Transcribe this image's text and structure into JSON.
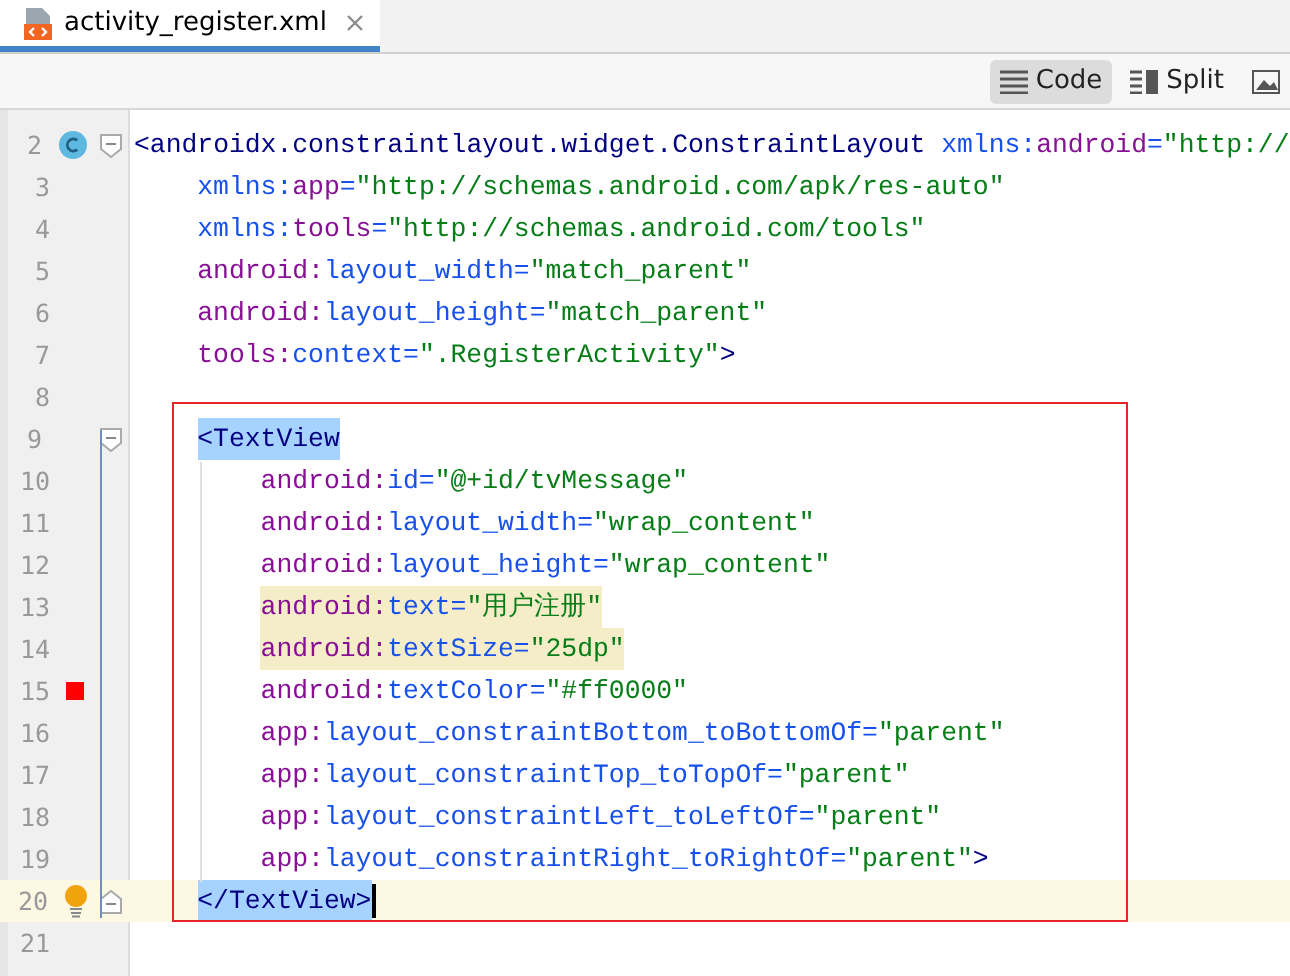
{
  "tabs": [
    {
      "label": "activity_register.xml",
      "selected": true
    }
  ],
  "view_modes": [
    {
      "label": "Code",
      "selected": true
    },
    {
      "label": "Split",
      "selected": false
    },
    {
      "selected": false
    }
  ],
  "lines": [
    {
      "number": "2",
      "gutter": [
        {
          "kind": "class"
        },
        {
          "kind": "fold-start"
        }
      ],
      "segments": [
        {
          "kind": "tag",
          "text": "<androidx.constraintlayout.widget.ConstraintLayout"
        },
        {
          "kind": "attr",
          "text": "xmlns:"
        },
        {
          "kind": "prefix",
          "text": "android"
        },
        {
          "kind": "attr",
          "text": "="
        },
        {
          "kind": "value",
          "text": "\"http://"
        }
      ],
      "children": [
        {
          "number": "3",
          "segments": [
            {
              "kind": "attr",
              "text": "xmlns:"
            },
            {
              "kind": "prefix",
              "text": "app"
            },
            {
              "kind": "attr",
              "text": "="
            },
            {
              "kind": "value",
              "text": "\"http://schemas.android.com/apk/res-auto\""
            }
          ]
        },
        {
          "number": "4",
          "segments": [
            {
              "kind": "attr",
              "text": "xmlns:"
            },
            {
              "kind": "prefix",
              "text": "tools"
            },
            {
              "kind": "attr",
              "text": "="
            },
            {
              "kind": "value",
              "text": "\"http://schemas.android.com/tools\""
            }
          ]
        },
        {
          "number": "5",
          "segments": [
            {
              "kind": "prefix",
              "text": "android:"
            },
            {
              "kind": "attr",
              "text": "layout_width="
            },
            {
              "kind": "value",
              "text": "\"match_parent\""
            }
          ]
        },
        {
          "number": "6",
          "segments": [
            {
              "kind": "prefix",
              "text": "android:"
            },
            {
              "kind": "attr",
              "text": "layout_height="
            },
            {
              "kind": "value",
              "text": "\"match_parent\""
            }
          ]
        },
        {
          "number": "7",
          "segments": [
            {
              "kind": "prefix",
              "text": "tools:"
            },
            {
              "kind": "attr",
              "text": "context="
            },
            {
              "kind": "value",
              "text": "\".RegisterActivity\""
            },
            {
              "kind": "tag",
              "text": ">"
            }
          ]
        },
        {
          "number": "8"
        },
        {
          "number": "9",
          "gutter": [
            {
              "kind": "fold-start"
            }
          ],
          "segments": [
            {
              "kind": "tag",
              "text": "<TextView",
              "selected": true
            }
          ],
          "children": [
            {
              "number": "10",
              "segments": [
                {
                  "kind": "prefix",
                  "text": "android:"
                },
                {
                  "kind": "attr",
                  "text": "id="
                },
                {
                  "kind": "value",
                  "text": "\"@+id/tvMessage\""
                }
              ]
            },
            {
              "number": "11",
              "segments": [
                {
                  "kind": "prefix",
                  "text": "android:"
                },
                {
                  "kind": "attr",
                  "text": "layout_width="
                },
                {
                  "kind": "value",
                  "text": "\"wrap_content\""
                }
              ]
            },
            {
              "number": "12",
              "segments": [
                {
                  "kind": "prefix",
                  "text": "android:"
                },
                {
                  "kind": "attr",
                  "text": "layout_height="
                },
                {
                  "kind": "value",
                  "text": "\"wrap_content\""
                }
              ]
            },
            {
              "number": "13",
              "highlighted": true,
              "segments": [
                {
                  "kind": "prefix",
                  "text": "android:"
                },
                {
                  "kind": "attr",
                  "text": "text="
                },
                {
                  "kind": "value",
                  "text": "\"用户注册\""
                }
              ]
            },
            {
              "number": "14",
              "highlighted": true,
              "segments": [
                {
                  "kind": "prefix",
                  "text": "android:"
                },
                {
                  "kind": "attr",
                  "text": "textSize="
                },
                {
                  "kind": "value",
                  "text": "\"25dp\""
                }
              ]
            },
            {
              "number": "15",
              "gutter": [
                {
                  "kind": "color",
                  "color": "#ff0000"
                }
              ],
              "segments": [
                {
                  "kind": "prefix",
                  "text": "android:"
                },
                {
                  "kind": "attr",
                  "text": "textColor="
                },
                {
                  "kind": "value",
                  "text": "\"#ff0000\""
                }
              ]
            },
            {
              "number": "16",
              "segments": [
                {
                  "kind": "prefix",
                  "text": "app:"
                },
                {
                  "kind": "attr",
                  "text": "layout_constraintBottom_toBottomOf="
                },
                {
                  "kind": "value",
                  "text": "\"parent\""
                }
              ]
            },
            {
              "number": "17",
              "segments": [
                {
                  "kind": "prefix",
                  "text": "app:"
                },
                {
                  "kind": "attr",
                  "text": "layout_constraintTop_toTopOf="
                },
                {
                  "kind": "value",
                  "text": "\"parent\""
                }
              ]
            },
            {
              "number": "18",
              "segments": [
                {
                  "kind": "prefix",
                  "text": "app:"
                },
                {
                  "kind": "attr",
                  "text": "layout_constraintLeft_toLeftOf="
                },
                {
                  "kind": "value",
                  "text": "\"parent\""
                }
              ]
            },
            {
              "number": "19",
              "segments": [
                {
                  "kind": "prefix",
                  "text": "app:"
                },
                {
                  "kind": "attr",
                  "text": "layout_constraintRight_toRightOf="
                },
                {
                  "kind": "value",
                  "text": "\"parent\""
                },
                {
                  "kind": "tag",
                  "text": ">"
                }
              ]
            }
          ]
        },
        {
          "number": "20",
          "current": true,
          "caret": true,
          "gutter": [
            {
              "kind": "bulb"
            },
            {
              "kind": "fold-end"
            }
          ],
          "segments": [
            {
              "kind": "tag",
              "text": "</TextView>",
              "selected": true
            }
          ]
        },
        {
          "number": "21"
        }
      ]
    }
  ]
}
